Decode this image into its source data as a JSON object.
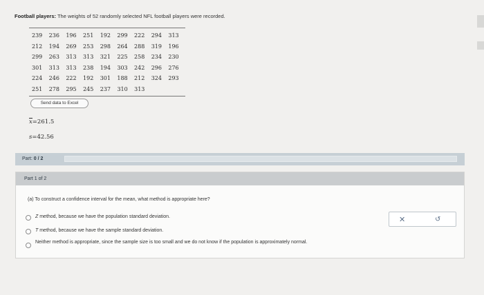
{
  "intro": {
    "label": "Football players:",
    "text": " The weights of 52 randomly selected NFL football players were recorded."
  },
  "data_rows": [
    [
      "239",
      "236",
      "196",
      "251",
      "192",
      "299",
      "222",
      "294",
      "313"
    ],
    [
      "212",
      "194",
      "269",
      "253",
      "298",
      "264",
      "288",
      "319",
      "196"
    ],
    [
      "299",
      "263",
      "313",
      "313",
      "321",
      "225",
      "258",
      "234",
      "230"
    ],
    [
      "301",
      "313",
      "313",
      "238",
      "194",
      "303",
      "242",
      "296",
      "276"
    ],
    [
      "224",
      "246",
      "222",
      "192",
      "301",
      "188",
      "212",
      "324",
      "293"
    ],
    [
      "251",
      "278",
      "295",
      "245",
      "237",
      "310",
      "313"
    ]
  ],
  "excel_button": "Send data to Excel",
  "stats": {
    "mean_symbol": "x",
    "mean_value": "=261.5",
    "sd_symbol": "s",
    "sd_value": "=42.56"
  },
  "part_bar": {
    "label": "Part:",
    "value": "0 / 2",
    "progress": 0.0
  },
  "part_panel": {
    "header": "Part 1 of 2",
    "question": "(a) To construct a confidence interval for the mean, what method is appropriate here?",
    "options": [
      {
        "letter": "Z",
        "text": " method, because we have the population standard deviation."
      },
      {
        "letter": "T",
        "text": " method, because we have the sample standard deviation."
      },
      {
        "letter": "",
        "text": "Neither method is appropriate, since the sample size is too small and we do not know if the population is approximately normal."
      }
    ]
  },
  "actions": {
    "clear_glyph": "✕",
    "undo_glyph": "↺"
  }
}
